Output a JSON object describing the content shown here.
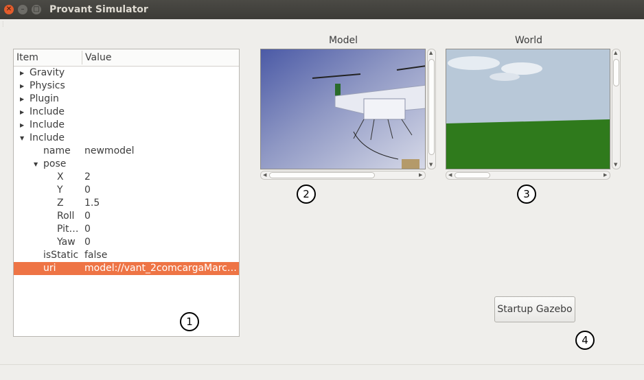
{
  "window": {
    "title": "Provant Simulator"
  },
  "tree": {
    "headers": {
      "item": "Item",
      "value": "Value"
    },
    "rows": [
      {
        "label": "Gravity",
        "value": ""
      },
      {
        "label": "Physics",
        "value": ""
      },
      {
        "label": "Plugin",
        "value": ""
      },
      {
        "label": "Include",
        "value": ""
      },
      {
        "label": "Include",
        "value": ""
      },
      {
        "label": "Include",
        "value": ""
      },
      {
        "label": "name",
        "value": "newmodel"
      },
      {
        "label": "pose",
        "value": ""
      },
      {
        "label": "X",
        "value": "2"
      },
      {
        "label": "Y",
        "value": "0"
      },
      {
        "label": "Z",
        "value": "1.5"
      },
      {
        "label": "Roll",
        "value": "0"
      },
      {
        "label": "Pit…",
        "value": "0"
      },
      {
        "label": "Yaw",
        "value": "0"
      },
      {
        "label": "isStatic",
        "value": "false"
      },
      {
        "label": "uri",
        "value": "model://vant_2comcargaMarc…"
      }
    ]
  },
  "views": {
    "model": {
      "title": "Model"
    },
    "world": {
      "title": "World"
    }
  },
  "annotations": {
    "n1": "1",
    "n2": "2",
    "n3": "3",
    "n4": "4"
  },
  "buttons": {
    "startup": "Startup Gazebo"
  },
  "colors": {
    "selection": "#ee7445",
    "titlebar": "#3c3b37",
    "close": "#e35c2c"
  }
}
